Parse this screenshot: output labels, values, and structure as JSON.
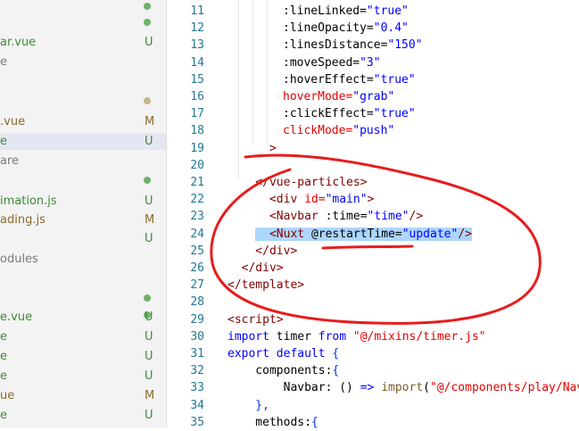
{
  "sidebar": {
    "items": [
      {
        "label": "",
        "badge": "",
        "dot": "green"
      },
      {
        "label": "",
        "badge": "",
        "dot": "green"
      },
      {
        "label": "ar.vue",
        "badge": "U",
        "color": "green"
      },
      {
        "label": "e",
        "badge": "",
        "color": "gray"
      },
      {
        "label": "",
        "badge": ""
      },
      {
        "label": "",
        "badge": "",
        "dot": "brown"
      },
      {
        "label": ".vue",
        "badge": "M",
        "color": "brown"
      },
      {
        "label": "e",
        "badge": "U",
        "color": "green",
        "selected": true
      },
      {
        "label": "are",
        "badge": "",
        "color": "gray"
      },
      {
        "label": "",
        "badge": "",
        "dot": "green"
      },
      {
        "label": "imation.js",
        "badge": "U",
        "color": "green"
      },
      {
        "label": "ading.js",
        "badge": "M",
        "color": "brown"
      },
      {
        "label": "",
        "badge": "U",
        "color": "green"
      },
      {
        "label": "odules",
        "badge": "",
        "color": "gray"
      },
      {
        "label": "",
        "badge": ""
      },
      {
        "label": "",
        "badge": "",
        "dot": "green"
      },
      {
        "label": "",
        "badge": "",
        "dot": "green"
      },
      {
        "label": "e.vue",
        "badge": "U",
        "color": "green"
      },
      {
        "label": "e",
        "badge": "U",
        "color": "green"
      },
      {
        "label": "e",
        "badge": "U",
        "color": "green"
      },
      {
        "label": "e",
        "badge": "U",
        "color": "green"
      },
      {
        "label": "ue",
        "badge": "M",
        "color": "brown"
      },
      {
        "label": "e",
        "badge": "U",
        "color": "green"
      }
    ]
  },
  "editor": {
    "lines": [
      {
        "n": "11",
        "tokens": [
          {
            "t": ":lineLinked=",
            "c": "plain"
          },
          {
            "t": "\"true\"",
            "c": "str"
          }
        ]
      },
      {
        "n": "12",
        "tokens": [
          {
            "t": ":lineOpacity=",
            "c": "plain"
          },
          {
            "t": "\"0.4\"",
            "c": "str"
          }
        ]
      },
      {
        "n": "13",
        "tokens": [
          {
            "t": ":linesDistance=",
            "c": "plain"
          },
          {
            "t": "\"150\"",
            "c": "str"
          }
        ]
      },
      {
        "n": "14",
        "tokens": [
          {
            "t": ":moveSpeed=",
            "c": "plain"
          },
          {
            "t": "\"3\"",
            "c": "str"
          }
        ]
      },
      {
        "n": "15",
        "tokens": [
          {
            "t": ":hoverEffect=",
            "c": "plain"
          },
          {
            "t": "\"true\"",
            "c": "str"
          }
        ]
      },
      {
        "n": "16",
        "tokens": [
          {
            "t": "hoverMode=",
            "c": "attr"
          },
          {
            "t": "\"grab\"",
            "c": "str"
          }
        ]
      },
      {
        "n": "17",
        "tokens": [
          {
            "t": ":clickEffect=",
            "c": "plain"
          },
          {
            "t": "\"true\"",
            "c": "str"
          }
        ]
      },
      {
        "n": "18",
        "tokens": [
          {
            "t": "clickMode=",
            "c": "attr"
          },
          {
            "t": "\"push\"",
            "c": "str"
          }
        ]
      },
      {
        "n": "19",
        "tokens": [
          {
            "t": "      >",
            "c": "tag"
          }
        ]
      },
      {
        "n": "20",
        "tokens": []
      },
      {
        "n": "21",
        "tokens": [
          {
            "t": "    </vue-particles>",
            "c": "tag"
          }
        ]
      },
      {
        "n": "22",
        "tokens": [
          {
            "t": "      <div ",
            "c": "tag"
          },
          {
            "t": "id=",
            "c": "attr"
          },
          {
            "t": "\"main\"",
            "c": "str"
          },
          {
            "t": ">",
            "c": "tag"
          }
        ]
      },
      {
        "n": "23",
        "tokens": [
          {
            "t": "      <Navbar ",
            "c": "tag"
          },
          {
            "t": ":time=",
            "c": "plain"
          },
          {
            "t": "\"time\"",
            "c": "str"
          },
          {
            "t": "/>",
            "c": "tag"
          }
        ]
      },
      {
        "n": "24",
        "tokens": [
          {
            "t": "    ",
            "c": "plain"
          },
          {
            "t": "  <Nuxt ",
            "c": "tag",
            "sel": true
          },
          {
            "t": "@restartTime=",
            "c": "plain",
            "sel": true
          },
          {
            "t": "\"update\"",
            "c": "str",
            "sel": true
          },
          {
            "t": "/>",
            "c": "tag",
            "sel": true
          }
        ]
      },
      {
        "n": "25",
        "tokens": [
          {
            "t": "    </div>",
            "c": "tag"
          }
        ]
      },
      {
        "n": "26",
        "tokens": [
          {
            "t": "  </div>",
            "c": "tag"
          }
        ]
      },
      {
        "n": "27",
        "tokens": [
          {
            "t": "</template>",
            "c": "tag"
          }
        ]
      },
      {
        "n": "28",
        "tokens": []
      },
      {
        "n": "29",
        "tokens": [
          {
            "t": "<script>",
            "c": "tag"
          }
        ]
      },
      {
        "n": "30",
        "tokens": [
          {
            "t": "import ",
            "c": "kw"
          },
          {
            "t": "timer ",
            "c": "plain"
          },
          {
            "t": "from ",
            "c": "kw"
          },
          {
            "t": "\"@/mixins/timer.js\"",
            "c": "attr"
          }
        ]
      },
      {
        "n": "31",
        "tokens": [
          {
            "t": "export default ",
            "c": "kw"
          },
          {
            "t": "{",
            "c": "br"
          }
        ]
      },
      {
        "n": "32",
        "tokens": [
          {
            "t": "    components:",
            "c": "plain"
          },
          {
            "t": "{",
            "c": "br"
          }
        ]
      },
      {
        "n": "33",
        "tokens": [
          {
            "t": "        Navbar: ",
            "c": "plain"
          },
          {
            "t": "() ",
            "c": "plain"
          },
          {
            "t": "=> ",
            "c": "kw"
          },
          {
            "t": "import",
            "c": "fn"
          },
          {
            "t": "(",
            "c": "plain"
          },
          {
            "t": "\"@/components/play/Navb",
            "c": "attr"
          }
        ]
      },
      {
        "n": "34",
        "tokens": [
          {
            "t": "    },",
            "c": "br"
          }
        ]
      },
      {
        "n": "35",
        "tokens": [
          {
            "t": "    methods:",
            "c": "plain"
          },
          {
            "t": "{",
            "c": "br"
          }
        ]
      }
    ]
  }
}
